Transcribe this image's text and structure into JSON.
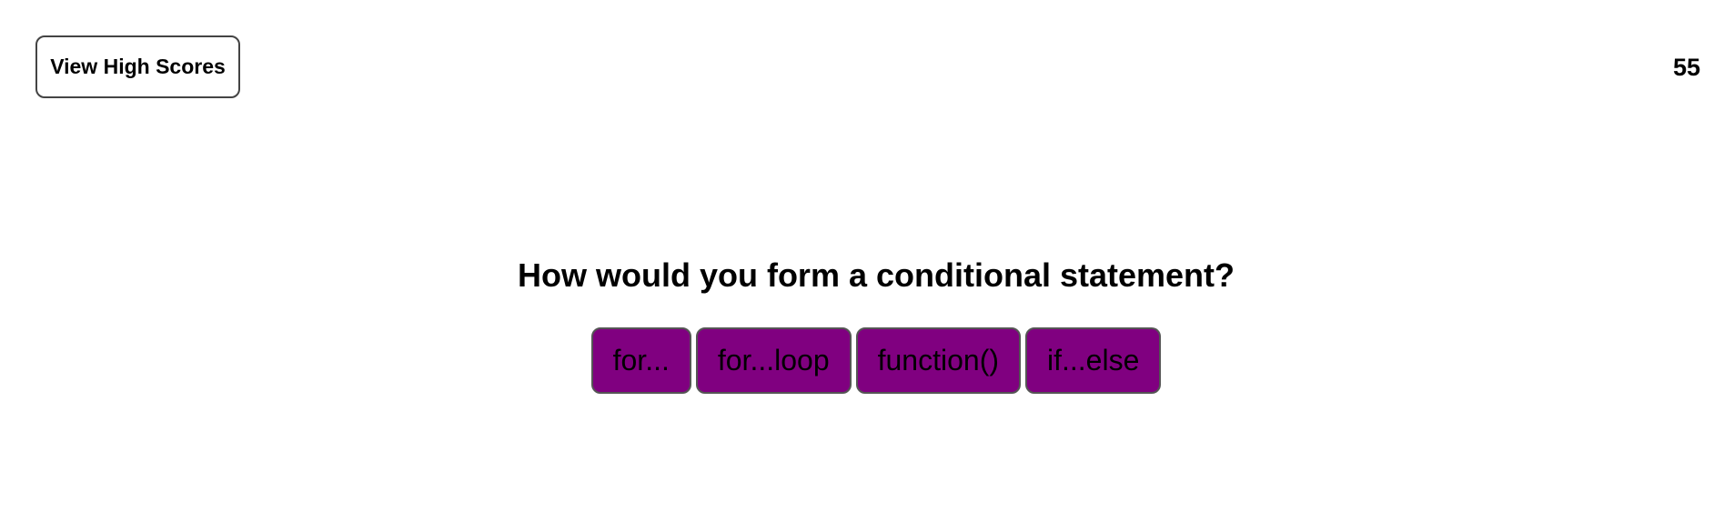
{
  "header": {
    "high_scores_label": "View High Scores",
    "timer_value": "55"
  },
  "quiz": {
    "question": "How would you form a conditional statement?",
    "choices": [
      {
        "label": "for..."
      },
      {
        "label": "for...loop"
      },
      {
        "label": "function()"
      },
      {
        "label": "if...else"
      }
    ]
  },
  "colors": {
    "choice_background": "#800080",
    "page_background": "#ffffff"
  }
}
